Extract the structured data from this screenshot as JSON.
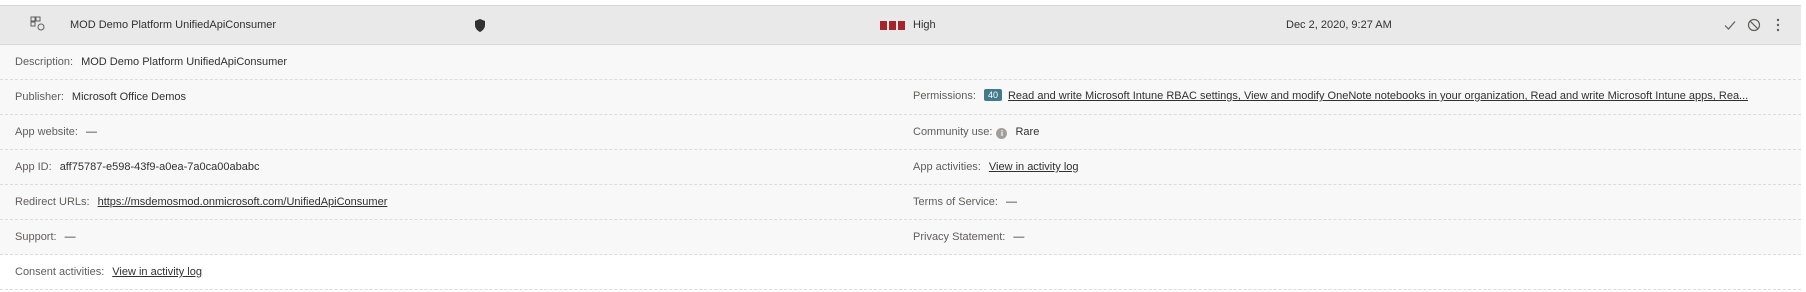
{
  "header": {
    "app_name": "MOD Demo Platform UnifiedApiConsumer",
    "risk_label": "High",
    "date": "Dec 2, 2020, 9:27 AM",
    "risk_color": "#a4262c",
    "icons": [
      "app-icon",
      "shield-icon",
      "approve-icon",
      "ban-icon",
      "more-icon"
    ]
  },
  "details": {
    "description": {
      "label": "Description:",
      "value": "MOD Demo Platform UnifiedApiConsumer"
    },
    "publisher": {
      "label": "Publisher:",
      "value": "Microsoft Office Demos"
    },
    "permissions": {
      "label": "Permissions:",
      "count": "40",
      "value": "Read and write Microsoft Intune RBAC settings, View and modify OneNote notebooks in your organization, Read and write Microsoft Intune apps, Rea..."
    },
    "app_website": {
      "label": "App website:",
      "value": "—"
    },
    "community_use": {
      "label": "Community use:",
      "value": "Rare"
    },
    "app_id": {
      "label": "App ID:",
      "value": "aff75787-e598-43f9-a0ea-7a0ca00ababc"
    },
    "app_activities": {
      "label": "App activities:",
      "value": "View in activity log"
    },
    "redirect_urls": {
      "label": "Redirect URLs:",
      "value": "https://msdemosmod.onmicrosoft.com/UnifiedApiConsumer"
    },
    "terms_of_service": {
      "label": "Terms of Service:",
      "value": "—"
    },
    "support": {
      "label": "Support:",
      "value": "—"
    },
    "privacy_statement": {
      "label": "Privacy Statement:",
      "value": "—"
    },
    "consent_activities": {
      "label": "Consent activities:",
      "value": "View in activity log"
    }
  }
}
